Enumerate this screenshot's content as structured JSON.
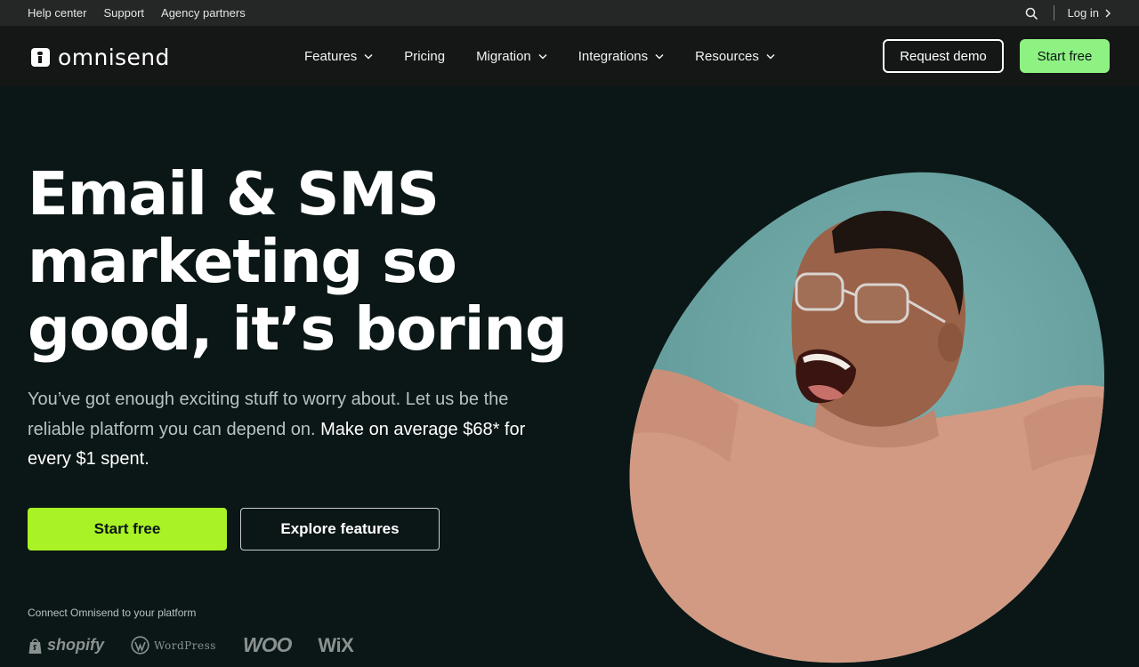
{
  "util_bar": {
    "links": [
      "Help center",
      "Support",
      "Agency partners"
    ],
    "login": "Log in"
  },
  "nav": {
    "logo": "omnisend",
    "menu": [
      "Features",
      "Pricing",
      "Migration",
      "Integrations",
      "Resources"
    ],
    "request_demo": "Request demo",
    "start_free": "Start free"
  },
  "hero": {
    "title_lines": [
      "Email & SMS",
      "marketing so",
      "good, it’s boring"
    ],
    "subtitle_plain": "You’ve got enough exciting stuff to worry about. Let us be the reliable platform you can depend on. ",
    "subtitle_strong": "Make on average $68* for every $1 spent.",
    "cta_primary": "Start free",
    "cta_secondary": "Explore features",
    "connect_label": "Connect Omnisend to your platform",
    "platforms": [
      "shopify",
      "WordPress",
      "WOO",
      "WiX"
    ]
  },
  "colors": {
    "background": "#0b1616",
    "nav_bg": "#151616",
    "util_bg": "#252727",
    "accent_green": "#8ef283",
    "cta_lime": "#a9f225",
    "photo_teal": "#6fa7a6",
    "sweater": "#d29a83"
  },
  "icons": [
    "search-icon",
    "chevron-right-icon",
    "chevron-down-icon",
    "shopify-bag-icon",
    "wordpress-icon"
  ]
}
